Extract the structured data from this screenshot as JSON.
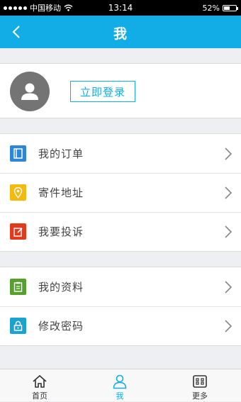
{
  "status_bar": {
    "carrier": "中国移动",
    "time": "13:14",
    "battery": "52%",
    "battery_level": 0.52
  },
  "header": {
    "title": "我",
    "back_icon": "chevron-left-icon"
  },
  "profile": {
    "avatar_icon": "user-silhouette-icon",
    "login_label": "立即登录"
  },
  "menu_groups": [
    {
      "items": [
        {
          "label": "我的订单",
          "icon": "order-book-icon",
          "color": "#2f86d8"
        },
        {
          "label": "寄件地址",
          "icon": "location-pin-icon",
          "color": "#f3b90c"
        },
        {
          "label": "我要投诉",
          "icon": "edit-note-icon",
          "color": "#e23a1c"
        }
      ]
    },
    {
      "items": [
        {
          "label": "我的资料",
          "icon": "clipboard-icon",
          "color": "#57a02d"
        },
        {
          "label": "修改密码",
          "icon": "lock-icon",
          "color": "#1ba3cf"
        }
      ]
    }
  ],
  "tab_bar": {
    "active": "我",
    "tabs": [
      {
        "label": "首页",
        "icon": "home-icon"
      },
      {
        "label": "我",
        "icon": "person-icon"
      },
      {
        "label": "更多",
        "icon": "more-grid-icon"
      }
    ]
  },
  "colors": {
    "accent": "#12ace6",
    "background": "#eeeff3"
  }
}
